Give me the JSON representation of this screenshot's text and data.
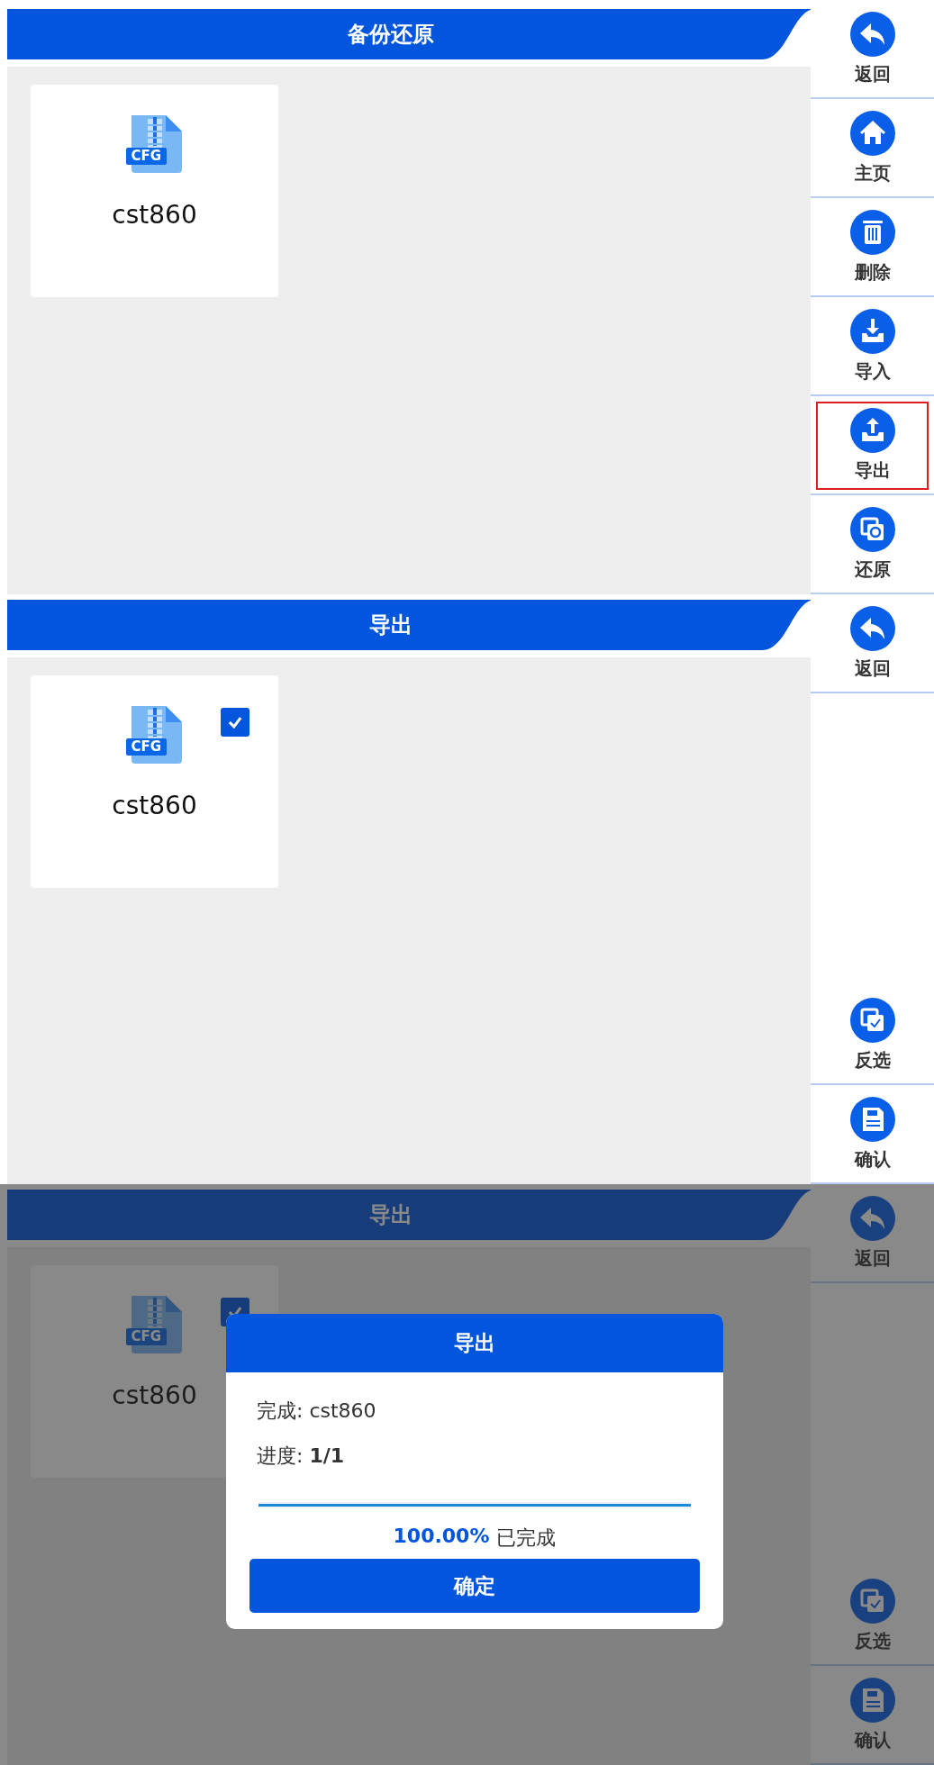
{
  "panels": [
    {
      "header": {
        "title": "备份还原"
      },
      "dimmed": false,
      "files": [
        {
          "name": "cst860",
          "type_label": "CFG"
        }
      ],
      "sidebar": {
        "top": [
          {
            "label": "返回",
            "kind": "back",
            "highlighted": false
          },
          {
            "label": "主页",
            "kind": "home",
            "highlighted": false
          },
          {
            "label": "删除",
            "kind": "trash",
            "highlighted": false
          },
          {
            "label": "导入",
            "kind": "import",
            "highlighted": false
          },
          {
            "label": "导出",
            "kind": "export",
            "highlighted": true
          },
          {
            "label": "还原",
            "kind": "restore",
            "highlighted": false
          }
        ]
      }
    },
    {
      "header": {
        "title": "导出"
      },
      "dimmed": false,
      "files": [
        {
          "name": "cst860",
          "type_label": "CFG",
          "checked": true
        }
      ],
      "sidebar": {
        "top": [
          {
            "label": "返回",
            "kind": "back",
            "highlighted": false
          }
        ],
        "bottom": [
          {
            "label": "反选",
            "kind": "invert",
            "highlighted": false
          },
          {
            "label": "确认",
            "kind": "save",
            "highlighted": false
          }
        ]
      }
    },
    {
      "header": {
        "title": "导出"
      },
      "dimmed": true,
      "files": [
        {
          "name": "cst860",
          "type_label": "CFG",
          "checked": true
        }
      ],
      "sidebar": {
        "top": [
          {
            "label": "返回",
            "kind": "back",
            "highlighted": false
          }
        ],
        "bottom": [
          {
            "label": "反选",
            "kind": "invert",
            "highlighted": false
          },
          {
            "label": "确认",
            "kind": "save",
            "highlighted": false
          }
        ]
      },
      "dialog": {
        "title": "导出",
        "lines": [
          "完成: cst860",
          "进度: **1/1**"
        ],
        "level": 1,
        "percent": "100.00%",
        "status": "已完成",
        "button": "确定"
      }
    }
  ]
}
